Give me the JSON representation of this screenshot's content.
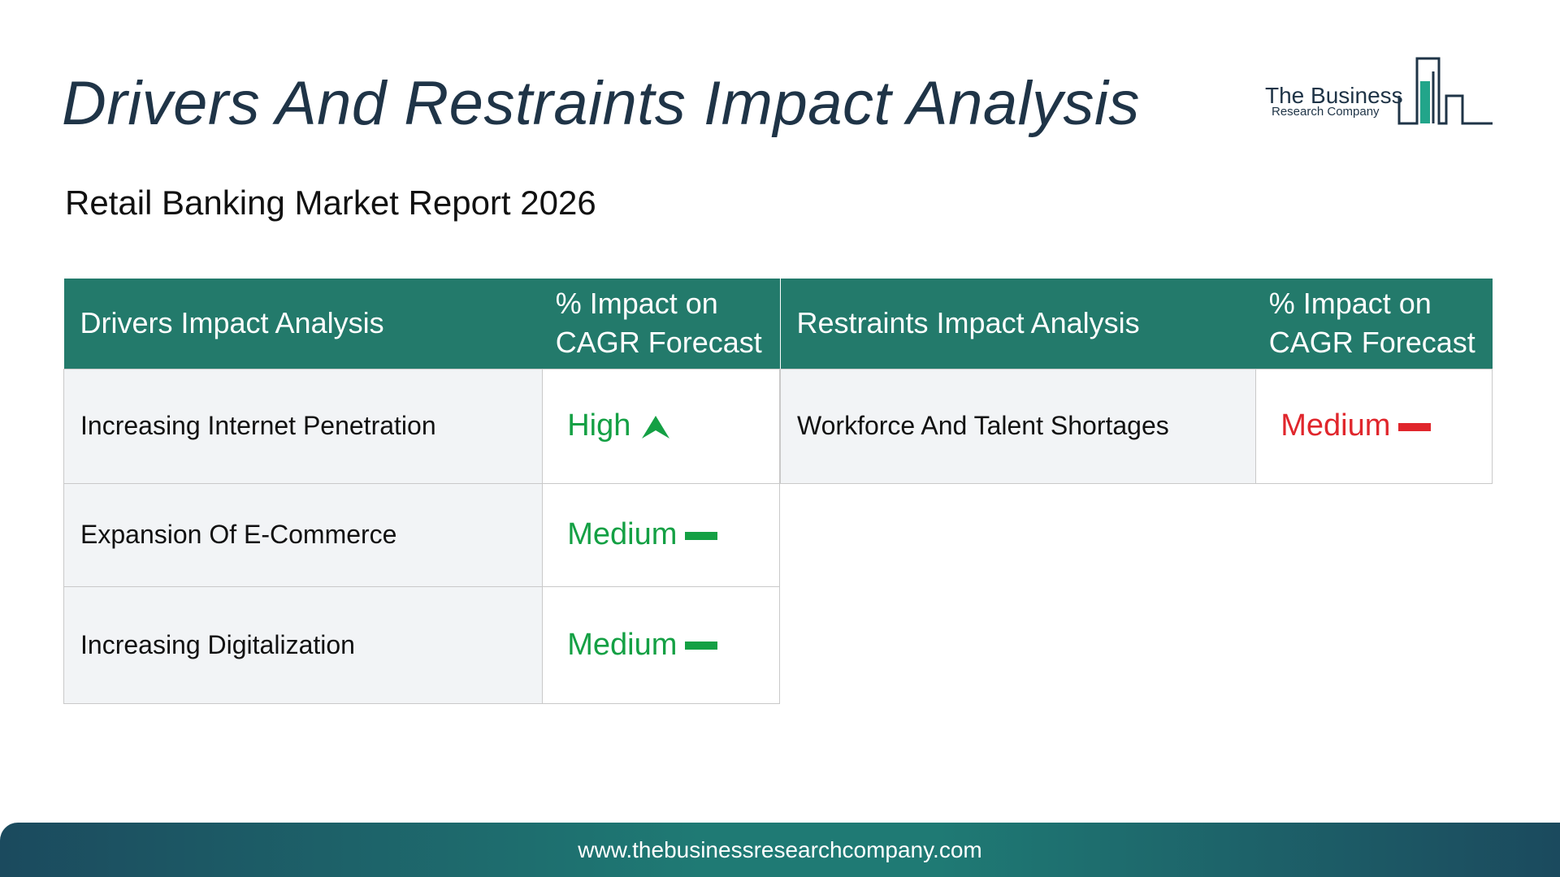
{
  "title": "Drivers And Restraints Impact Analysis",
  "subtitle": "Retail Banking Market Report 2026",
  "logo": {
    "line1": "The Business",
    "line2": "Research Company"
  },
  "drivers_table": {
    "header_label": "Drivers Impact Analysis",
    "header_impact": "% Impact on CAGR Forecast",
    "rows": [
      {
        "label": "Increasing Internet Penetration",
        "impact": "High",
        "trend": "up-arrow-icon"
      },
      {
        "label": "Expansion Of E-Commerce",
        "impact": "Medium",
        "trend": "dash-icon"
      },
      {
        "label": "Increasing Digitalization",
        "impact": "Medium",
        "trend": "dash-icon"
      }
    ]
  },
  "restraints_table": {
    "header_label": "Restraints Impact Analysis",
    "header_impact": "% Impact on CAGR Forecast",
    "rows": [
      {
        "label": "Workforce And Talent Shortages",
        "impact": "Medium",
        "trend": "dash-icon"
      }
    ]
  },
  "colors": {
    "header": "#237a6b",
    "driver_impact": "#14a044",
    "restraint_impact": "#e0262c",
    "title": "#1f3447"
  },
  "footer": {
    "url": "www.thebusinessresearchcompany.com"
  }
}
